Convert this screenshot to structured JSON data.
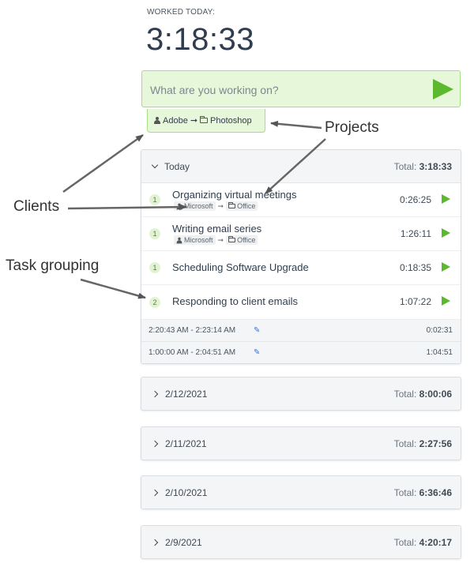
{
  "header": {
    "label": "WORKED TODAY:",
    "time": "3:18:33"
  },
  "entry": {
    "placeholder": "What are you working on?",
    "client": "Adobe",
    "arrow": "➞",
    "project": "Photoshop"
  },
  "today": {
    "label": "Today",
    "total_label": "Total:",
    "total": "3:18:33",
    "entries": [
      {
        "count": "1",
        "title": "Organizing virtual meetings",
        "client": "Microsoft",
        "project": "Office",
        "duration": "0:26:25"
      },
      {
        "count": "1",
        "title": "Writing email series",
        "client": "Microsoft",
        "project": "Office",
        "duration": "1:26:11"
      },
      {
        "count": "1",
        "title": "Scheduling Software Upgrade",
        "duration": "0:18:35"
      },
      {
        "count": "2",
        "title": "Responding to client emails",
        "duration": "1:07:22"
      }
    ],
    "subentries": [
      {
        "range": "2:20:43 AM - 2:23:14 AM",
        "duration": "0:02:31"
      },
      {
        "range": "1:00:00 AM - 2:04:51 AM",
        "duration": "1:04:51"
      }
    ]
  },
  "groups": [
    {
      "date": "2/12/2021",
      "total_label": "Total:",
      "total": "8:00:06"
    },
    {
      "date": "2/11/2021",
      "total_label": "Total:",
      "total": "2:27:56"
    },
    {
      "date": "2/10/2021",
      "total_label": "Total:",
      "total": "6:36:46"
    },
    {
      "date": "2/9/2021",
      "total_label": "Total:",
      "total": "4:20:17"
    }
  ],
  "annotations": {
    "clients": "Clients",
    "projects": "Projects",
    "task_grouping": "Task grouping"
  },
  "colors": {
    "accent_green": "#5bb82f",
    "entry_bg": "#e6f8d9",
    "pencil_blue": "#3b6fd8"
  }
}
